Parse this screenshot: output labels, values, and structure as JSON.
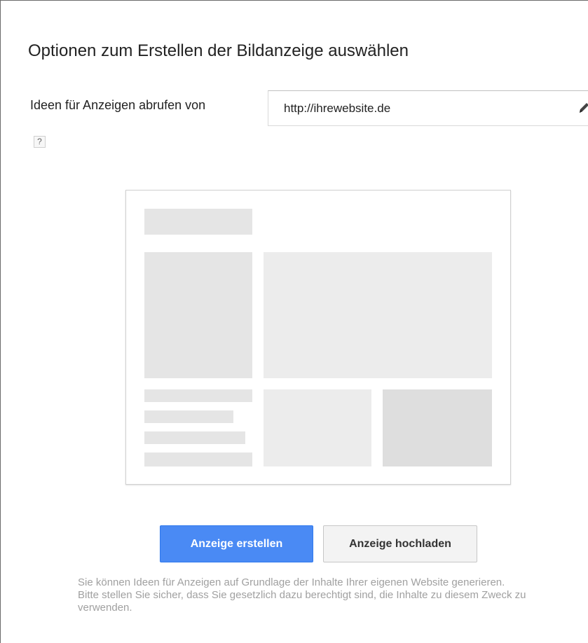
{
  "dialog": {
    "title": "Optionen zum Erstellen der Bildanzeige auswählen",
    "url_label": "Ideen für Anzeigen abrufen von",
    "url_value": "http://ihrewebsite.de",
    "help_icon": "?",
    "icons": {
      "edit": "pencil-icon",
      "help": "help-icon"
    },
    "buttons": {
      "create_label": "Anzeige erstellen",
      "upload_label": "Anzeige hochladen"
    },
    "note": "Sie können Ideen für Anzeigen auf Grundlage der Inhalte Ihrer eigenen Website generieren. Bitte stellen Sie sicher, dass Sie gesetzlich dazu berechtigt sind, die Inhalte zu diesem Zweck zu verwenden."
  },
  "colors": {
    "primary_button": "#4a8af4",
    "secondary_button": "#f3f3f3",
    "placeholder_block": "#e5e5e5",
    "note_text": "#a0a0a0"
  }
}
